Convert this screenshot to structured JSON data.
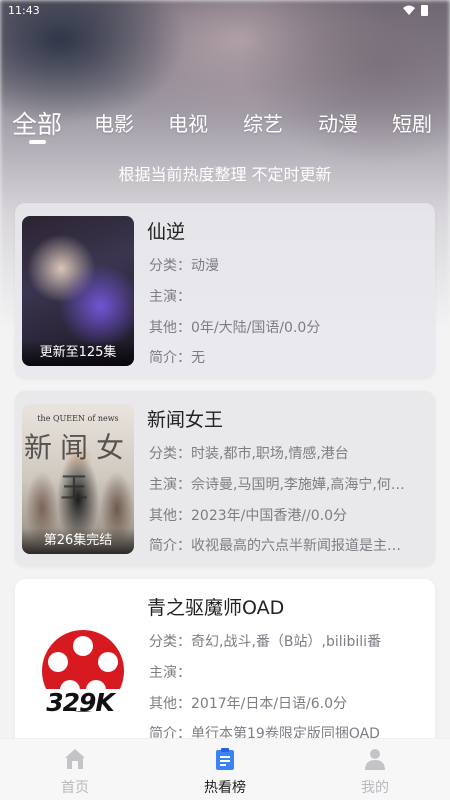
{
  "status_bar": {
    "time": "11:43"
  },
  "tabs": [
    {
      "label": "全部",
      "active": true
    },
    {
      "label": "电影",
      "active": false
    },
    {
      "label": "电视",
      "active": false
    },
    {
      "label": "综艺",
      "active": false
    },
    {
      "label": "动漫",
      "active": false
    },
    {
      "label": "短剧",
      "active": false
    }
  ],
  "subtitle": "根据当前热度整理 不定时更新",
  "items": [
    {
      "title": "仙逆",
      "poster_caption": "更新至125集",
      "category": "分类：动漫",
      "cast": "主演：",
      "other": "其他：0年/大陆/国语/0.0分",
      "intro": "简介：无"
    },
    {
      "title": "新闻女王",
      "poster_caption": "第26集完结",
      "poster_text": "新闻女王",
      "poster_subtext": "the QUEEN of news",
      "category": "分类：时装,都市,职场,情感,港台",
      "cast": "主演：佘诗曼,马国明,李施嬅,高海宁,何…",
      "other": "其他：2023年/中国香港//0.0分",
      "intro": "简介：收视最高的六点半新闻报道是主…"
    },
    {
      "title": "青之驱魔师OAD",
      "poster_caption": "",
      "poster_brand": "329K",
      "category": "分类：奇幻,战斗,番（B站）,bilibili番",
      "cast": "主演：",
      "other": "其他：2017年/日本/日语/6.0分",
      "intro": "简介：单行本第19卷限定版同捆OAD"
    }
  ],
  "bottom_nav": [
    {
      "label": "首页",
      "icon": "home-icon",
      "active": false
    },
    {
      "label": "热看榜",
      "icon": "clipboard-icon",
      "active": true
    },
    {
      "label": "我的",
      "icon": "user-icon",
      "active": false
    }
  ],
  "colors": {
    "active_icon": "#3b82f6",
    "inactive": "#b8b8bd",
    "brand_red": "#d71920"
  }
}
